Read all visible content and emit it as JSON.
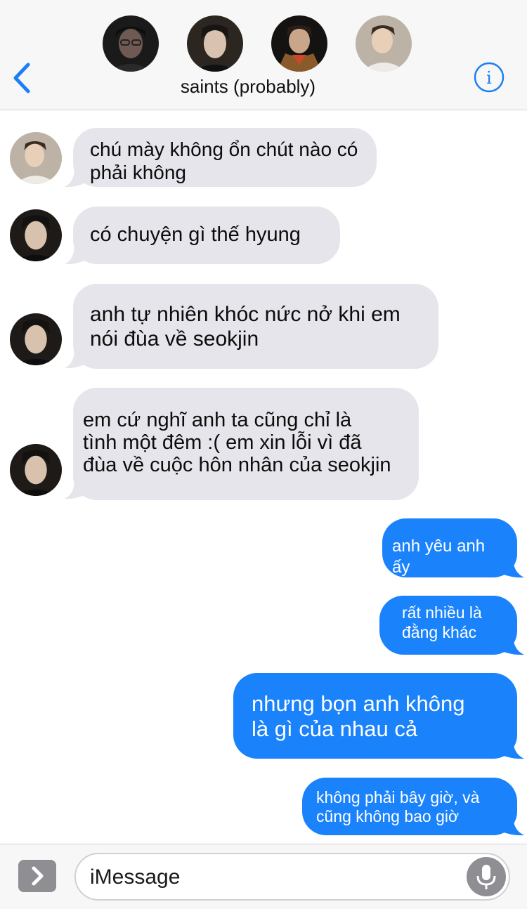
{
  "header": {
    "title": "saints (probably)",
    "back_icon": "chevron-left-icon",
    "info_icon": "info-icon",
    "accent": "#1a7ff5"
  },
  "messages": [
    {
      "direction": "in",
      "text_lines": [
        "chú mày không ổn chút nào có",
        "phải không"
      ]
    },
    {
      "direction": "in",
      "text_lines": [
        "có chuyện gì thế hyung"
      ]
    },
    {
      "direction": "in",
      "text_lines": [
        "anh tự nhiên khóc nức nở khi em",
        "nói đùa về seokjin"
      ]
    },
    {
      "direction": "in",
      "text_lines": [
        "em cứ nghĩ anh ta cũng chỉ là",
        "tình một đêm :( em xin lỗi vì đã",
        "đùa về cuộc hôn nhân của seokjin"
      ]
    },
    {
      "direction": "out",
      "text_lines": [
        "anh yêu anh ấy"
      ]
    },
    {
      "direction": "out",
      "text_lines": [
        "rất nhiều là",
        "đằng khác"
      ]
    },
    {
      "direction": "out",
      "text_lines": [
        "nhưng bọn anh không",
        "là gì của nhau cả"
      ]
    },
    {
      "direction": "out",
      "text_lines": [
        "không phải bây giờ, và",
        "cũng không bao giờ"
      ]
    }
  ],
  "composer": {
    "placeholder": "iMessage",
    "apps_icon": "chevron-right-icon",
    "mic_icon": "microphone-icon"
  },
  "colors": {
    "incoming_bubble": "#e6e5eb",
    "outgoing_bubble": "#1a82fb",
    "header_bg": "#f7f7f7"
  }
}
